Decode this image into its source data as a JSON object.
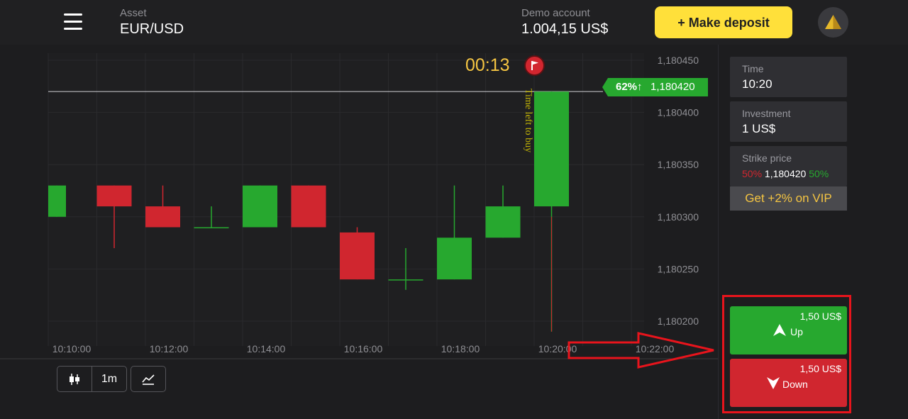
{
  "header": {
    "asset_label": "Asset",
    "asset_value": "EUR/USD",
    "account_label": "Demo account",
    "account_balance": "1.004,15 US$",
    "deposit_button": "+ Make deposit"
  },
  "chart_data": {
    "type": "candlestick",
    "price_axis_ticks": [
      "1,180450",
      "1,180400",
      "1,180350",
      "1,180300",
      "1,180250",
      "1,180200"
    ],
    "time_axis_ticks": [
      "10:10:00",
      "10:12:00",
      "10:14:00",
      "10:16:00",
      "10:18:00",
      "10:20:00",
      "10:22:00"
    ],
    "candles": [
      {
        "time": "10:10:00",
        "open": 1.1803,
        "close": 1.18033,
        "high": 1.18033,
        "low": 1.1803,
        "color": "green"
      },
      {
        "time": "10:11:00",
        "open": 1.18033,
        "close": 1.18031,
        "high": 1.18033,
        "low": 1.18027,
        "color": "red"
      },
      {
        "time": "10:12:00",
        "open": 1.18031,
        "close": 1.18029,
        "high": 1.18033,
        "low": 1.18029,
        "color": "red"
      },
      {
        "time": "10:13:00",
        "open": 1.18029,
        "close": 1.18029,
        "high": 1.18031,
        "low": 1.18029,
        "color": "green"
      },
      {
        "time": "10:14:00",
        "open": 1.18029,
        "close": 1.18033,
        "high": 1.18033,
        "low": 1.18029,
        "color": "green"
      },
      {
        "time": "10:15:00",
        "open": 1.18033,
        "close": 1.18029,
        "high": 1.18033,
        "low": 1.18029,
        "color": "red"
      },
      {
        "time": "10:16:00",
        "open": 1.180285,
        "close": 1.18024,
        "high": 1.18029,
        "low": 1.18024,
        "color": "red"
      },
      {
        "time": "10:17:00",
        "open": 1.18024,
        "close": 1.18024,
        "high": 1.18027,
        "low": 1.18023,
        "color": "green"
      },
      {
        "time": "10:18:00",
        "open": 1.18024,
        "close": 1.18028,
        "high": 1.18033,
        "low": 1.18024,
        "color": "green"
      },
      {
        "time": "10:19:00",
        "open": 1.18028,
        "close": 1.18031,
        "high": 1.18033,
        "low": 1.18028,
        "color": "green"
      },
      {
        "time": "10:20:00",
        "open": 1.18031,
        "close": 1.18042,
        "high": 1.18042,
        "low": 1.18019,
        "color": "green"
      }
    ],
    "current_price": "1,180420",
    "current_percent": "62%↑",
    "grid": true
  },
  "chart_overlay": {
    "timer": "00:13",
    "time_left_text": "Time left to buy"
  },
  "toolbar": {
    "interval": "1m"
  },
  "sidebar": {
    "time_label": "Time",
    "time_value": "10:20",
    "investment_label": "Investment",
    "investment_value": "1 US$",
    "strike_label": "Strike price",
    "strike_down_pct": "50%",
    "strike_value": "1,180420",
    "strike_up_pct": "50%",
    "vip_label": "Get +2% on VIP"
  },
  "trade": {
    "up_amount": "1,50 US$",
    "up_label": "Up",
    "down_amount": "1,50 US$",
    "down_label": "Down"
  },
  "colors": {
    "up": "#27a82f",
    "down": "#d0262f",
    "accent": "#ffe03a",
    "annotation": "#e8141c"
  }
}
